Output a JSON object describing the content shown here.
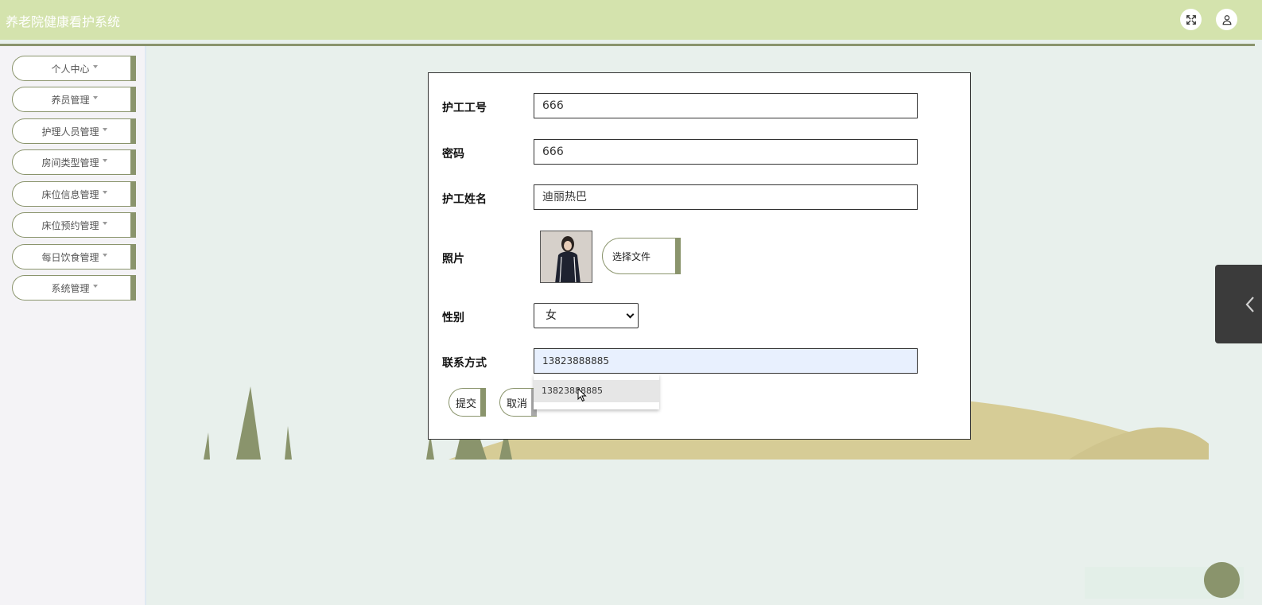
{
  "header": {
    "title": "养老院健康看护系统",
    "fullscreen_icon": "expand-icon",
    "user_icon": "user-icon"
  },
  "sidebar": {
    "items": [
      {
        "label": "个人中心"
      },
      {
        "label": "养员管理"
      },
      {
        "label": "护理人员管理"
      },
      {
        "label": "房间类型管理"
      },
      {
        "label": "床位信息管理"
      },
      {
        "label": "床位预约管理"
      },
      {
        "label": "每日饮食管理"
      },
      {
        "label": "系统管理"
      }
    ]
  },
  "form": {
    "worker_id_label": "护工工号",
    "worker_id_value": "666",
    "password_label": "密码",
    "password_value": "666",
    "name_label": "护工姓名",
    "name_value": "迪丽热巴",
    "photo_label": "照片",
    "file_button": "选择文件",
    "gender_label": "性别",
    "gender_value": "女",
    "phone_label": "联系方式",
    "phone_value": "13823888885",
    "autofill_option": "13823888885",
    "submit_label": "提交",
    "cancel_label": "取消"
  },
  "colors": {
    "header_bg": "#d4e3ad",
    "accent": "#8a946c",
    "page_bg": "#e8f0ec",
    "hill": "#d6cc96"
  }
}
